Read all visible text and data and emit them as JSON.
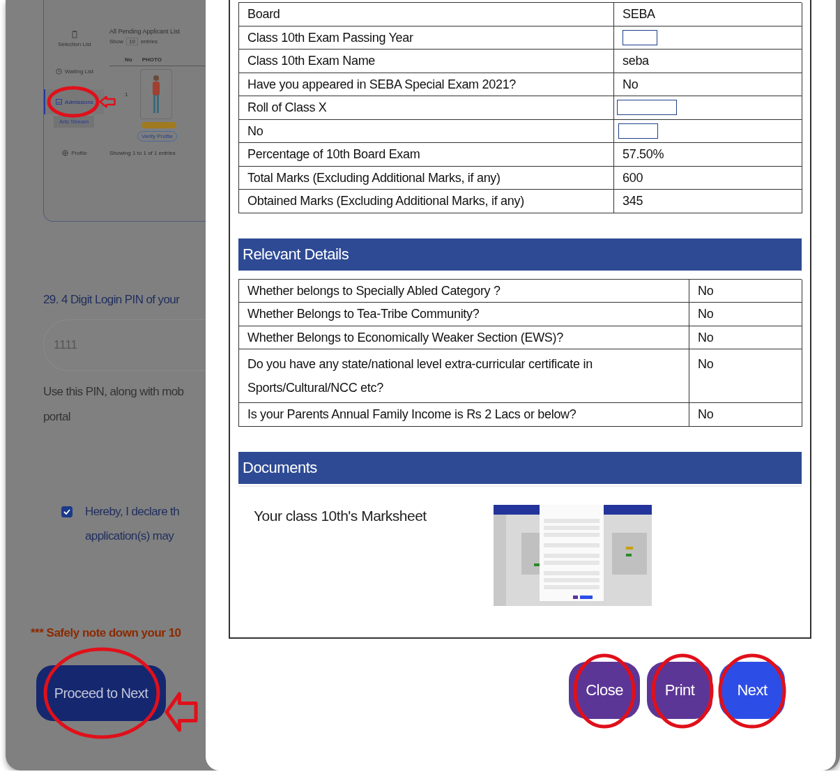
{
  "background_page": {
    "embedded_screenshot": {
      "sidebar_items": [
        {
          "label": "Selection List",
          "kind": "clipboard",
          "selected": false
        },
        {
          "label": "Waiting List",
          "kind": "clock",
          "selected": false
        },
        {
          "label": "Admissions",
          "kind": "card",
          "selected": true,
          "children": [
            {
              "label": "Arts Stream"
            }
          ]
        },
        {
          "label": "Profile",
          "kind": "globe",
          "selected": false
        }
      ],
      "list_title": "All Pending Applicant List",
      "show_label": "Show",
      "page_size": "10",
      "entries_label": "entries",
      "columns": [
        "No",
        "PHOTO"
      ],
      "rows": [
        {
          "no": "1",
          "action": "Verify Profile"
        }
      ],
      "footer": "Showing 1 to 1 of 1 entries"
    },
    "pin_question": "29. 4 Digit Login PIN of your",
    "pin_value": "1111",
    "pin_hint_lines": [
      "Use this PIN, along with mob",
      "portal"
    ],
    "declaration": {
      "checked": true,
      "lines": [
        "Hereby, I declare th",
        "application(s) may"
      ]
    },
    "warning": "*** Safely note down your 10",
    "proceed_button": "Proceed to Next"
  },
  "modal": {
    "exam_rows": [
      {
        "label": "Board",
        "kind": "text",
        "value": "SEBA"
      },
      {
        "label": "Class 10th Exam Passing Year",
        "kind": "input"
      },
      {
        "label": "Class 10th Exam Name",
        "kind": "text",
        "value": "seba"
      },
      {
        "label": "Have you appeared in SEBA Special Exam 2021?",
        "kind": "text",
        "value": "No"
      },
      {
        "label": "Roll of Class X",
        "kind": "input"
      },
      {
        "label": "No",
        "kind": "input"
      },
      {
        "label": "Percentage of 10th Board Exam",
        "kind": "text",
        "value": "57.50%"
      },
      {
        "label": "Total Marks (Excluding Additional Marks, if any)",
        "kind": "text",
        "value": "600"
      },
      {
        "label": "Obtained Marks (Excluding Additional Marks, if any)",
        "kind": "text",
        "value": "345"
      }
    ],
    "relevant_title": "Relevant Details",
    "relevant_rows": [
      {
        "label": "Whether belongs to Specially Abled Category ?",
        "value": "No"
      },
      {
        "label": "Whether Belongs to Tea-Tribe Community?",
        "value": "No"
      },
      {
        "label": "Whether Belongs to Economically Weaker Section (EWS)?",
        "value": "No"
      },
      {
        "label": "Do you have any state/national level extra-curricular certificate in Sports/Cultural/NCC etc?",
        "value": "No"
      },
      {
        "label": "Is your Parents Annual Family Income is Rs 2 Lacs or below?",
        "value": "No"
      }
    ],
    "documents_title": "Documents",
    "documents": [
      {
        "label": "Your class 10th's Marksheet"
      }
    ],
    "buttons": [
      {
        "label": "Close",
        "kind": "secondary"
      },
      {
        "label": "Print",
        "kind": "secondary"
      },
      {
        "label": "Next",
        "kind": "primary"
      }
    ]
  }
}
